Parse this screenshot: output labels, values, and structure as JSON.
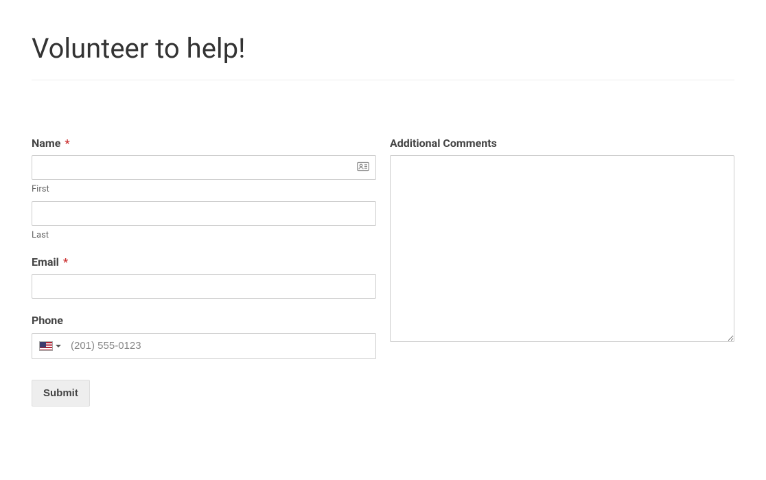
{
  "page": {
    "title": "Volunteer to help!"
  },
  "form": {
    "name": {
      "label": "Name",
      "required_mark": "*",
      "first_sublabel": "First",
      "last_sublabel": "Last",
      "first_value": "",
      "last_value": ""
    },
    "email": {
      "label": "Email",
      "required_mark": "*",
      "value": ""
    },
    "phone": {
      "label": "Phone",
      "country_icon_name": "us-flag",
      "placeholder": "(201) 555-0123",
      "value": ""
    },
    "comments": {
      "label": "Additional Comments",
      "value": ""
    },
    "submit_label": "Submit"
  },
  "icons": {
    "contact_card": "contact-card-icon",
    "caret_down": "chevron-down-icon"
  }
}
